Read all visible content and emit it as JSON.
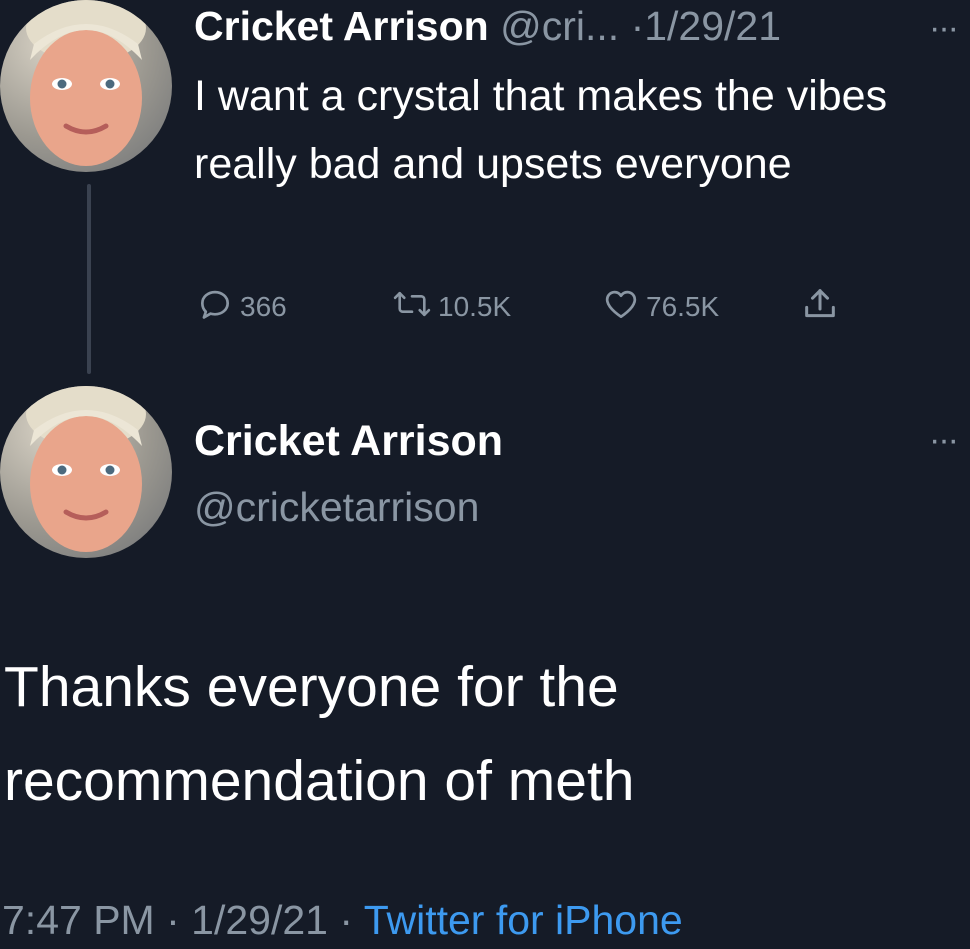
{
  "tweet1": {
    "display_name": "Cricket Arrison",
    "handle_truncated": "@cri...",
    "separator": "·",
    "date": "1/29/21",
    "more_label": "···",
    "text": "I want a crystal that makes the vibes really bad and upsets everyone",
    "stats": {
      "replies": "366",
      "retweets": "10.5K",
      "likes": "76.5K"
    }
  },
  "tweet2": {
    "display_name": "Cricket Arrison",
    "handle": "@cricketarrison",
    "more_label": "···",
    "text": "Thanks everyone for the recommendation of meth",
    "time": "7:47 PM",
    "separator": "·",
    "date": "1/29/21",
    "source": "Twitter for iPhone"
  },
  "colors": {
    "background": "#151b27",
    "muted_text": "#8a96a3",
    "link": "#3d9af0"
  },
  "icons": {
    "reply": "reply-icon",
    "retweet": "retweet-icon",
    "like": "like-icon",
    "share": "share-icon"
  }
}
